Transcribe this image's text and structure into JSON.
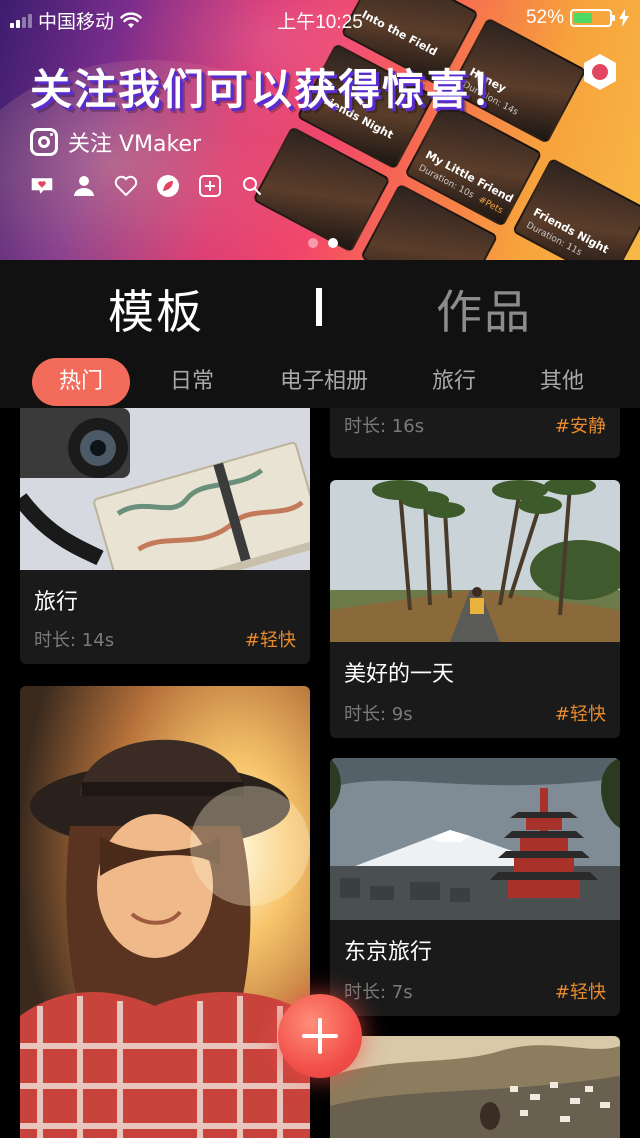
{
  "status_bar": {
    "carrier": "中国移动",
    "time": "上午10:25",
    "battery_percent": "52%",
    "battery_level": 0.52,
    "signal_icon": "signal-bars-icon",
    "wifi_icon": "wifi-icon",
    "charging_icon": "charging-bolt-icon"
  },
  "banner": {
    "headline": "关注我们可以获得惊喜！",
    "follow_text": "关注 VMaker",
    "social_icons": [
      "message-heart-icon",
      "person-icon",
      "heart-icon",
      "leaf-icon",
      "plus-square-icon",
      "search-icon"
    ],
    "pager": {
      "count": 2,
      "active_index": 1
    },
    "promo_cards": [
      {
        "title": "Into the Field",
        "duration": "",
        "tag": ""
      },
      {
        "title": "Honey",
        "duration": "Duration: 14s",
        "tag": ""
      },
      {
        "title": "Friends Night",
        "duration": "",
        "tag": ""
      },
      {
        "title": "My Little Friend",
        "duration": "Duration: 10s",
        "tag": "#Pets"
      },
      {
        "title": "Friends Night",
        "duration": "Duration: 11s",
        "tag": ""
      }
    ]
  },
  "main_tabs": {
    "active": "模板",
    "inactive": "作品"
  },
  "categories": [
    "热门",
    "日常",
    "电子相册",
    "旅行",
    "其他"
  ],
  "active_category_index": 0,
  "left_column": [
    {
      "title": "旅行",
      "duration": "时长: 14s",
      "tag": "#轻快"
    },
    {
      "title": "",
      "duration": "",
      "tag": ""
    }
  ],
  "right_column": [
    {
      "title": "",
      "duration": "时长: 16s",
      "tag": "#安静"
    },
    {
      "title": "美好的一天",
      "duration": "时长: 9s",
      "tag": "#轻快"
    },
    {
      "title": "东京旅行",
      "duration": "时长: 7s",
      "tag": "#轻快"
    },
    {
      "title": "",
      "duration": "",
      "tag": ""
    }
  ],
  "colors": {
    "accent": "#f26b5b",
    "tag": "#e88a2c",
    "card_bg": "#1a1a1a",
    "tab_bg": "#111111"
  }
}
